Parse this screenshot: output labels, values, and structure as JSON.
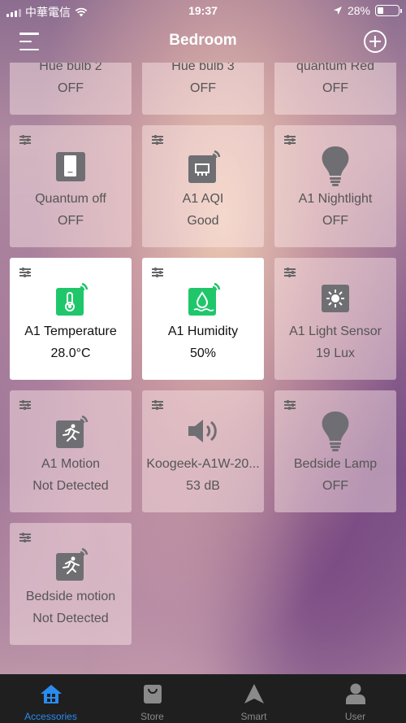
{
  "status_bar": {
    "carrier": "中華電信",
    "time": "19:37",
    "battery": "28%",
    "battery_level": 0.28
  },
  "header": {
    "title": "Bedroom"
  },
  "accessories": [
    {
      "name": "Hue bulb 2",
      "state": "OFF",
      "icon": "none",
      "active": false
    },
    {
      "name": "Hue bulb 3",
      "state": "OFF",
      "icon": "none",
      "active": false
    },
    {
      "name": "quantum Red",
      "state": "OFF",
      "icon": "none",
      "active": false
    },
    {
      "name": "Quantum off",
      "state": "OFF",
      "icon": "switch-icon",
      "active": false
    },
    {
      "name": "A1 AQI",
      "state": "Good",
      "icon": "air-quality-sensor-icon",
      "active": false
    },
    {
      "name": "A1 Nightlight",
      "state": "OFF",
      "icon": "lightbulb-icon",
      "active": false
    },
    {
      "name": "A1 Temperature",
      "state": "28.0°C",
      "icon": "thermometer-sensor-icon",
      "active": true
    },
    {
      "name": "A1 Humidity",
      "state": "50%",
      "icon": "humidity-sensor-icon",
      "active": true
    },
    {
      "name": "A1 Light Sensor",
      "state": "19 Lux",
      "icon": "light-sensor-icon",
      "active": false
    },
    {
      "name": "A1 Motion",
      "state": "Not Detected",
      "icon": "motion-sensor-icon",
      "active": false
    },
    {
      "name": "Koogeek-A1W-20...",
      "state": "53 dB",
      "icon": "speaker-icon",
      "active": false
    },
    {
      "name": "Bedside Lamp",
      "state": "OFF",
      "icon": "lightbulb-icon",
      "active": false
    },
    {
      "name": "Bedside motion",
      "state": "Not Detected",
      "icon": "motion-sensor-icon",
      "active": false
    }
  ],
  "tab_bar": {
    "tabs": [
      {
        "label": "Accessories",
        "icon": "home-icon",
        "active": true
      },
      {
        "label": "Store",
        "icon": "shopping-bag-icon",
        "active": false
      },
      {
        "label": "Smart",
        "icon": "navigation-arrow-icon",
        "active": false
      },
      {
        "label": "User",
        "icon": "user-icon",
        "active": false
      }
    ]
  },
  "colors": {
    "accent": "#2a8cf0",
    "sensor_green": "#1fc76a",
    "tab_bar_bg": "#1f1f1f"
  }
}
